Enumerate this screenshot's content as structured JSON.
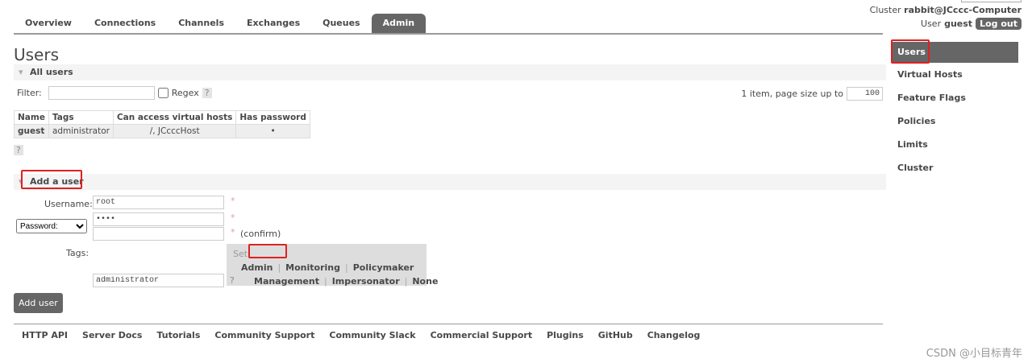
{
  "nav": {
    "tabs": [
      "Overview",
      "Connections",
      "Channels",
      "Exchanges",
      "Queues",
      "Admin"
    ],
    "active": "Admin"
  },
  "header": {
    "cluster_label": "Cluster",
    "cluster": "rabbit@JCccc-Computer",
    "user_label": "User",
    "user": "guest",
    "logout": "Log out"
  },
  "page_title": "Users",
  "all_users": {
    "title": "All users",
    "filter_label": "Filter:",
    "filter_value": "",
    "regex_label": "Regex",
    "help": "?",
    "paging": "1 item, page size up to",
    "page_size": "100",
    "columns": [
      "Name",
      "Tags",
      "Can access virtual hosts",
      "Has password"
    ],
    "rows": [
      {
        "name": "guest",
        "tags": "administrator",
        "vhosts": "/, JCcccHost",
        "has_password": "•"
      }
    ]
  },
  "add_user": {
    "title": "Add a user",
    "username_label": "Username:",
    "username": "root",
    "password_mode": "Password:",
    "password": "••••",
    "confirm": "(confirm)",
    "required": "*",
    "tags_label": "Tags:",
    "set_label": "Set",
    "tag_options": [
      "Admin",
      "Monitoring",
      "Policymaker",
      "Management",
      "Impersonator",
      "None"
    ],
    "tags_value": "administrator",
    "help": "?",
    "submit": "Add user"
  },
  "sidebar": {
    "items": [
      "Users",
      "Virtual Hosts",
      "Feature Flags",
      "Policies",
      "Limits",
      "Cluster"
    ]
  },
  "footer": {
    "links": [
      "HTTP API",
      "Server Docs",
      "Tutorials",
      "Community Support",
      "Community Slack",
      "Commercial Support",
      "Plugins",
      "GitHub",
      "Changelog"
    ]
  },
  "watermark": "CSDN @小目标青年"
}
